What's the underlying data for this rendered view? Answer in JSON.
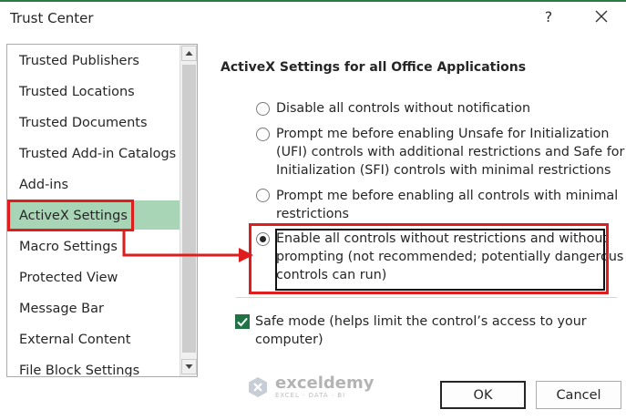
{
  "window": {
    "title": "Trust Center",
    "help_label": "?",
    "close_icon": "close-icon"
  },
  "sidebar": {
    "items": [
      {
        "label": "Trusted Publishers"
      },
      {
        "label": "Trusted Locations"
      },
      {
        "label": "Trusted Documents"
      },
      {
        "label": "Trusted Add-in Catalogs"
      },
      {
        "label": "Add-ins"
      },
      {
        "label": "ActiveX Settings",
        "selected": true
      },
      {
        "label": "Macro Settings"
      },
      {
        "label": "Protected View"
      },
      {
        "label": "Message Bar"
      },
      {
        "label": "External Content"
      },
      {
        "label": "File Block Settings"
      }
    ]
  },
  "main": {
    "heading": "ActiveX Settings for all Office Applications",
    "options": [
      {
        "lines": [
          "Disable all controls without notification"
        ],
        "selected": false
      },
      {
        "lines": [
          "Prompt me before enabling Unsafe for Initialization",
          "(UFI) controls with additional restrictions and Safe for",
          "Initialization (SFI) controls with minimal restrictions"
        ],
        "selected": false
      },
      {
        "lines": [
          "Prompt me before enabling all controls with minimal",
          "restrictions"
        ],
        "selected": false
      },
      {
        "lines": [
          "Enable all controls without restrictions and without",
          "prompting (not recommended; potentially dangerous",
          "controls can run)"
        ],
        "selected": true
      }
    ],
    "safe_mode": {
      "lines": [
        "Safe mode (helps limit the control’s access to your",
        "computer)"
      ],
      "checked": true
    }
  },
  "buttons": {
    "ok": "OK",
    "cancel": "Cancel"
  },
  "watermark": {
    "name": "exceldemy",
    "tagline": "EXCEL · DATA · BI"
  },
  "colors": {
    "selection": "#a8d5b6",
    "highlight": "#e01d1d",
    "checkbox": "#217346"
  }
}
